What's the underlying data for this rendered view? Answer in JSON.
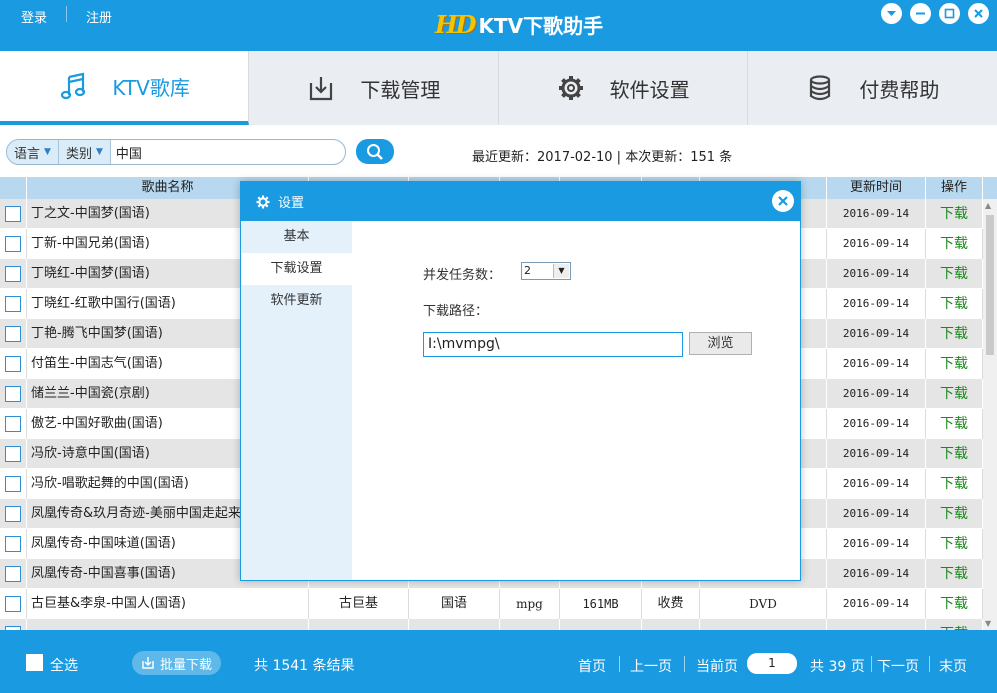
{
  "titlebar": {
    "login": "登录",
    "register": "注册",
    "logo_mark": "HD",
    "app_name": "KTV下歌助手"
  },
  "tabs": [
    {
      "label": "KTV歌库",
      "icon": "music-note-icon",
      "active": true
    },
    {
      "label": "下载管理",
      "icon": "download-icon",
      "active": false
    },
    {
      "label": "软件设置",
      "icon": "gear-icon",
      "active": false
    },
    {
      "label": "付费帮助",
      "icon": "database-icon",
      "active": false
    }
  ],
  "search": {
    "lang_filter": "语言",
    "type_filter": "类别",
    "query": "中国"
  },
  "update_info": "最近更新：2017-02-10 | 本次更新：151 条",
  "table": {
    "headers": {
      "name": "歌曲名称",
      "time": "更新时间",
      "op": "操作"
    },
    "rows": [
      {
        "name": "丁之文-中国梦(国语)",
        "singer": "",
        "lang": "",
        "fmt": "",
        "size": "",
        "fee": "",
        "quality": "",
        "time": "2016-09-14",
        "op": "下载"
      },
      {
        "name": "丁新-中国兄弟(国语)",
        "singer": "",
        "lang": "",
        "fmt": "",
        "size": "",
        "fee": "",
        "quality": "",
        "time": "2016-09-14",
        "op": "下载"
      },
      {
        "name": "丁晓红-中国梦(国语)",
        "singer": "",
        "lang": "",
        "fmt": "",
        "size": "",
        "fee": "",
        "quality": "",
        "time": "2016-09-14",
        "op": "下载"
      },
      {
        "name": "丁晓红-红歌中国行(国语)",
        "singer": "",
        "lang": "",
        "fmt": "",
        "size": "",
        "fee": "",
        "quality": "",
        "time": "2016-09-14",
        "op": "下载"
      },
      {
        "name": "丁艳-腾飞中国梦(国语)",
        "singer": "",
        "lang": "",
        "fmt": "",
        "size": "",
        "fee": "",
        "quality": "",
        "time": "2016-09-14",
        "op": "下载"
      },
      {
        "name": "付笛生-中国志气(国语)",
        "singer": "",
        "lang": "",
        "fmt": "",
        "size": "",
        "fee": "",
        "quality": "",
        "time": "2016-09-14",
        "op": "下载"
      },
      {
        "name": "储兰兰-中国瓷(京剧)",
        "singer": "",
        "lang": "",
        "fmt": "",
        "size": "",
        "fee": "",
        "quality": "",
        "time": "2016-09-14",
        "op": "下载"
      },
      {
        "name": "傲艺-中国好歌曲(国语)",
        "singer": "",
        "lang": "",
        "fmt": "",
        "size": "",
        "fee": "",
        "quality": "",
        "time": "2016-09-14",
        "op": "下载"
      },
      {
        "name": "冯欣-诗意中国(国语)",
        "singer": "",
        "lang": "",
        "fmt": "",
        "size": "",
        "fee": "",
        "quality": "",
        "time": "2016-09-14",
        "op": "下载"
      },
      {
        "name": "冯欣-唱歌起舞的中国(国语)",
        "singer": "",
        "lang": "",
        "fmt": "",
        "size": "",
        "fee": "",
        "quality": "",
        "time": "2016-09-14",
        "op": "下载"
      },
      {
        "name": "凤凰传奇&玖月奇迹-美丽中国走起来(国",
        "singer": "",
        "lang": "",
        "fmt": "",
        "size": "",
        "fee": "",
        "quality": "",
        "time": "2016-09-14",
        "op": "下载"
      },
      {
        "name": "凤凰传奇-中国味道(国语)",
        "singer": "",
        "lang": "",
        "fmt": "",
        "size": "",
        "fee": "",
        "quality": "",
        "time": "2016-09-14",
        "op": "下载"
      },
      {
        "name": "凤凰传奇-中国喜事(国语)",
        "singer": "",
        "lang": "",
        "fmt": "",
        "size": "",
        "fee": "",
        "quality": "",
        "time": "2016-09-14",
        "op": "下载"
      },
      {
        "name": "古巨基&李泉-中国人(国语)",
        "singer": "古巨基",
        "lang": "国语",
        "fmt": "mpg",
        "size": "161MB",
        "fee": "收费",
        "quality": "DVD",
        "time": "2016-09-14",
        "op": "下载"
      },
      {
        "name": "",
        "singer": "",
        "lang": "",
        "fmt": "",
        "size": "",
        "fee": "",
        "quality": "",
        "time": "",
        "op": "下载"
      }
    ]
  },
  "footer": {
    "select_all": "全选",
    "batch_download": "批量下载",
    "total": "共 1541 条结果",
    "first": "首页",
    "prev": "上一页",
    "current_label": "当前页",
    "current_page": "1",
    "pages": "共 39 页",
    "next": "下一页",
    "last": "末页"
  },
  "dialog": {
    "title": "设置",
    "nav": [
      {
        "label": "基本",
        "selected": false
      },
      {
        "label": "下载设置",
        "selected": true
      },
      {
        "label": "软件更新",
        "selected": false
      }
    ],
    "concurrent_label": "并发任务数：",
    "concurrent_value": "2",
    "path_label": "下载路径：",
    "path_value": "I:\\mvmpg\\",
    "browse": "浏览"
  },
  "colors": {
    "accent": "#1a9ae0",
    "download_green": "#1b8a1b",
    "row_alt": "#e5e5e5"
  }
}
